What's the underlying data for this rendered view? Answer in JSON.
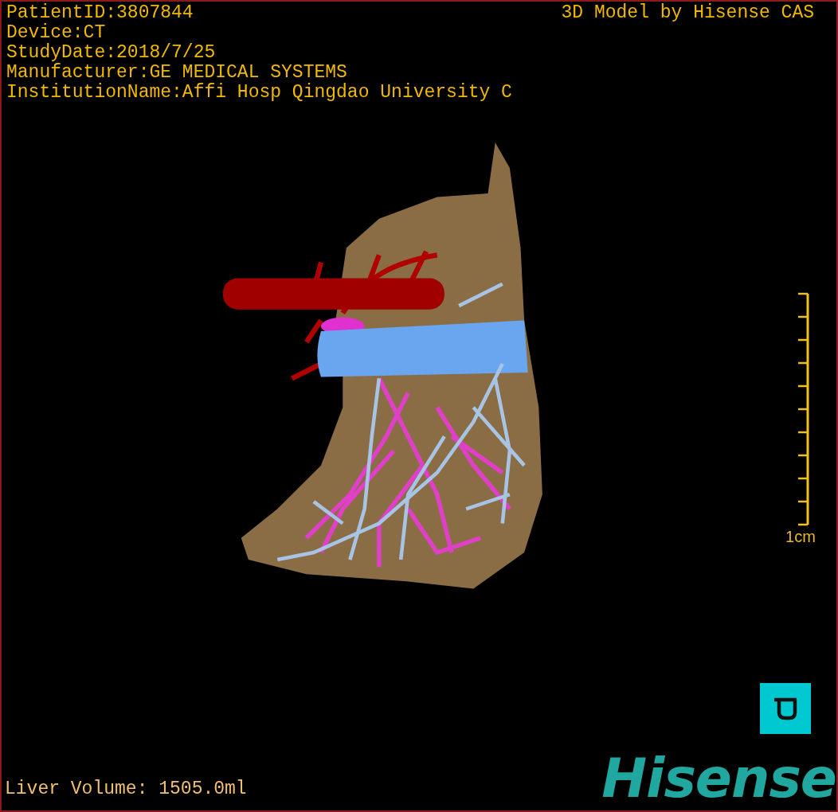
{
  "patient_info": [
    "PatientID:3807844",
    "Device:CT",
    "StudyDate:2018/7/25",
    "Manufacturer:GE MEDICAL SYSTEMS",
    "InstitutionName:Affi Hosp Qingdao University C"
  ],
  "model_title": "3D Model by Hisense CAS",
  "scale_bar": {
    "label": "1cm"
  },
  "liver_volume": "Liver Volume: 1505.0ml",
  "logo": "Hisense"
}
